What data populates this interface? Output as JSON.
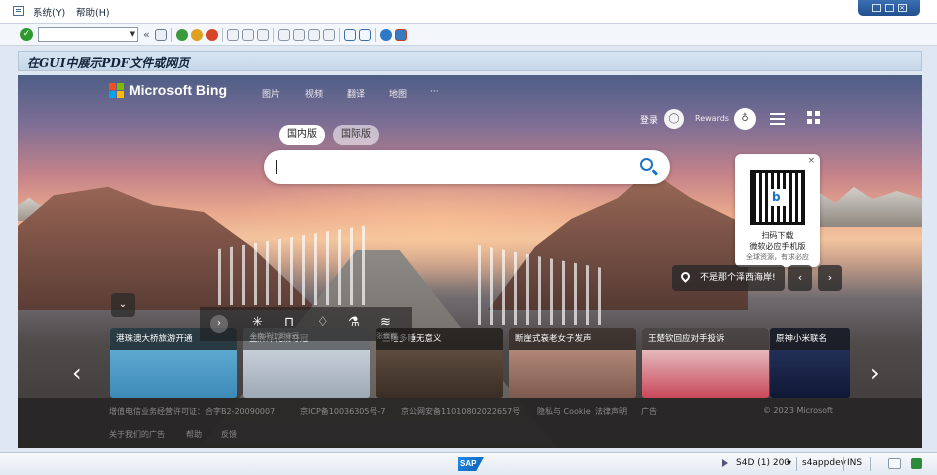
{
  "menubar": {
    "items": [
      "系统(Y)",
      "帮助(H)"
    ]
  },
  "window_controls": [
    "minimize-icon",
    "maximize-icon",
    "close-icon"
  ],
  "toolbar": {
    "command_field": "",
    "back_glyph": "«",
    "icons": [
      "enter-icon",
      "save-icon",
      "back-icon",
      "exit-icon",
      "cancel-icon",
      "print-icon",
      "find-icon",
      "find-next-icon",
      "first-page-icon",
      "prev-page-icon",
      "next-page-icon",
      "last-page-icon",
      "new-session-icon",
      "shortcut-icon",
      "help-icon",
      "customize-layout-icon"
    ]
  },
  "title": "在GUI中展示PDF文件或网页",
  "bing": {
    "logo_text": "Microsoft Bing",
    "logo_colors": [
      "#f25022",
      "#7fba00",
      "#00a4ef",
      "#ffb900"
    ],
    "nav": [
      "图片",
      "视频",
      "翻译",
      "地图",
      "···"
    ],
    "signin": "登录",
    "rewards": "Rewards",
    "tabs": [
      "国内版",
      "国际版"
    ],
    "search_value": "",
    "qr_card": {
      "close": "×",
      "line1": "扫码下载",
      "line2": "微软必应手机版",
      "line3": "全球资源，有求必应"
    },
    "image_info": "不是那个泽西海岸!",
    "prev": "‹",
    "next": "›",
    "collapse": "⌄",
    "tool_strip": {
      "arrow": "›",
      "icons": [
        "snowflake-icon",
        "frame-icon",
        "leaf-icon",
        "flask-icon",
        "wave-icon"
      ],
      "labels": [
        "全南洋江湖守冠",
        "张巍巍"
      ]
    },
    "news": [
      {
        "title": "港珠澳大桥旅游开通"
      },
      {
        "title": "金牌洋花滑夺冠"
      },
      {
        "title": "三睡多睡无意义"
      },
      {
        "title": "断崖式衰老女子发声"
      },
      {
        "title": "王楚钦回应对手投诉"
      },
      {
        "title": "原神小米联名"
      }
    ],
    "carousel_left": "‹",
    "carousel_right": "›",
    "footer": {
      "row1": [
        "增值电信业务经营许可证：合字B2-20090007",
        "京ICP备10036305号-7",
        "京公网安备11010802022657号",
        "隐私与 Cookie",
        "法律声明",
        "广告"
      ],
      "copyright": "© 2023 Microsoft",
      "row2": [
        "关于我们的广告",
        "帮助",
        "反馈"
      ]
    }
  },
  "statusbar": {
    "sap_logo": "SAP",
    "system": "S4D (1) 200",
    "dropdown": "▾",
    "server": "s4appdev",
    "mode": "INS"
  }
}
